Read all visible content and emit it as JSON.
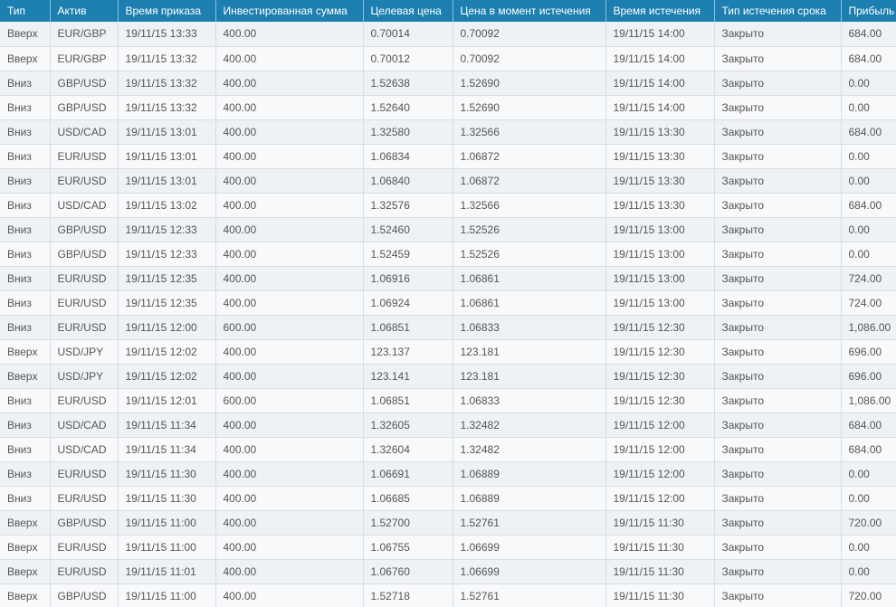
{
  "table": {
    "headers": [
      "Тип",
      "Актив",
      "Время приказа",
      "Инвестированная сумма",
      "Целевая цена",
      "Цена в момент истечения",
      "Время истечения",
      "Тип истечения срока",
      "Прибыль"
    ],
    "rows": [
      [
        "Вверх",
        "EUR/GBP",
        "19/11/15 13:33",
        "400.00",
        "0.70014",
        "0.70092",
        "19/11/15 14:00",
        "Закрыто",
        "684.00"
      ],
      [
        "Вверх",
        "EUR/GBP",
        "19/11/15 13:32",
        "400.00",
        "0.70012",
        "0.70092",
        "19/11/15 14:00",
        "Закрыто",
        "684.00"
      ],
      [
        "Вниз",
        "GBP/USD",
        "19/11/15 13:32",
        "400.00",
        "1.52638",
        "1.52690",
        "19/11/15 14:00",
        "Закрыто",
        "0.00"
      ],
      [
        "Вниз",
        "GBP/USD",
        "19/11/15 13:32",
        "400.00",
        "1.52640",
        "1.52690",
        "19/11/15 14:00",
        "Закрыто",
        "0.00"
      ],
      [
        "Вниз",
        "USD/CAD",
        "19/11/15 13:01",
        "400.00",
        "1.32580",
        "1.32566",
        "19/11/15 13:30",
        "Закрыто",
        "684.00"
      ],
      [
        "Вниз",
        "EUR/USD",
        "19/11/15 13:01",
        "400.00",
        "1.06834",
        "1.06872",
        "19/11/15 13:30",
        "Закрыто",
        "0.00"
      ],
      [
        "Вниз",
        "EUR/USD",
        "19/11/15 13:01",
        "400.00",
        "1.06840",
        "1.06872",
        "19/11/15 13:30",
        "Закрыто",
        "0.00"
      ],
      [
        "Вниз",
        "USD/CAD",
        "19/11/15 13:02",
        "400.00",
        "1.32576",
        "1.32566",
        "19/11/15 13:30",
        "Закрыто",
        "684.00"
      ],
      [
        "Вниз",
        "GBP/USD",
        "19/11/15 12:33",
        "400.00",
        "1.52460",
        "1.52526",
        "19/11/15 13:00",
        "Закрыто",
        "0.00"
      ],
      [
        "Вниз",
        "GBP/USD",
        "19/11/15 12:33",
        "400.00",
        "1.52459",
        "1.52526",
        "19/11/15 13:00",
        "Закрыто",
        "0.00"
      ],
      [
        "Вниз",
        "EUR/USD",
        "19/11/15 12:35",
        "400.00",
        "1.06916",
        "1.06861",
        "19/11/15 13:00",
        "Закрыто",
        "724.00"
      ],
      [
        "Вниз",
        "EUR/USD",
        "19/11/15 12:35",
        "400.00",
        "1.06924",
        "1.06861",
        "19/11/15 13:00",
        "Закрыто",
        "724.00"
      ],
      [
        "Вниз",
        "EUR/USD",
        "19/11/15 12:00",
        "600.00",
        "1.06851",
        "1.06833",
        "19/11/15 12:30",
        "Закрыто",
        "1,086.00"
      ],
      [
        "Вверх",
        "USD/JPY",
        "19/11/15 12:02",
        "400.00",
        "123.137",
        "123.181",
        "19/11/15 12:30",
        "Закрыто",
        "696.00"
      ],
      [
        "Вверх",
        "USD/JPY",
        "19/11/15 12:02",
        "400.00",
        "123.141",
        "123.181",
        "19/11/15 12:30",
        "Закрыто",
        "696.00"
      ],
      [
        "Вниз",
        "EUR/USD",
        "19/11/15 12:01",
        "600.00",
        "1.06851",
        "1.06833",
        "19/11/15 12:30",
        "Закрыто",
        "1,086.00"
      ],
      [
        "Вниз",
        "USD/CAD",
        "19/11/15 11:34",
        "400.00",
        "1.32605",
        "1.32482",
        "19/11/15 12:00",
        "Закрыто",
        "684.00"
      ],
      [
        "Вниз",
        "USD/CAD",
        "19/11/15 11:34",
        "400.00",
        "1.32604",
        "1.32482",
        "19/11/15 12:00",
        "Закрыто",
        "684.00"
      ],
      [
        "Вниз",
        "EUR/USD",
        "19/11/15 11:30",
        "400.00",
        "1.06691",
        "1.06889",
        "19/11/15 12:00",
        "Закрыто",
        "0.00"
      ],
      [
        "Вниз",
        "EUR/USD",
        "19/11/15 11:30",
        "400.00",
        "1.06685",
        "1.06889",
        "19/11/15 12:00",
        "Закрыто",
        "0.00"
      ],
      [
        "Вверх",
        "GBP/USD",
        "19/11/15 11:00",
        "400.00",
        "1.52700",
        "1.52761",
        "19/11/15 11:30",
        "Закрыто",
        "720.00"
      ],
      [
        "Вверх",
        "EUR/USD",
        "19/11/15 11:00",
        "400.00",
        "1.06755",
        "1.06699",
        "19/11/15 11:30",
        "Закрыто",
        "0.00"
      ],
      [
        "Вверх",
        "EUR/USD",
        "19/11/15 11:01",
        "400.00",
        "1.06760",
        "1.06699",
        "19/11/15 11:30",
        "Закрыто",
        "0.00"
      ],
      [
        "Вверх",
        "GBP/USD",
        "19/11/15 11:00",
        "400.00",
        "1.52718",
        "1.52761",
        "19/11/15 11:30",
        "Закрыто",
        "720.00"
      ]
    ]
  },
  "colors": {
    "header_bg": "#1c7fb0",
    "row_odd": "#eef1f5",
    "row_even": "#f8f9fb",
    "text": "#555555"
  }
}
